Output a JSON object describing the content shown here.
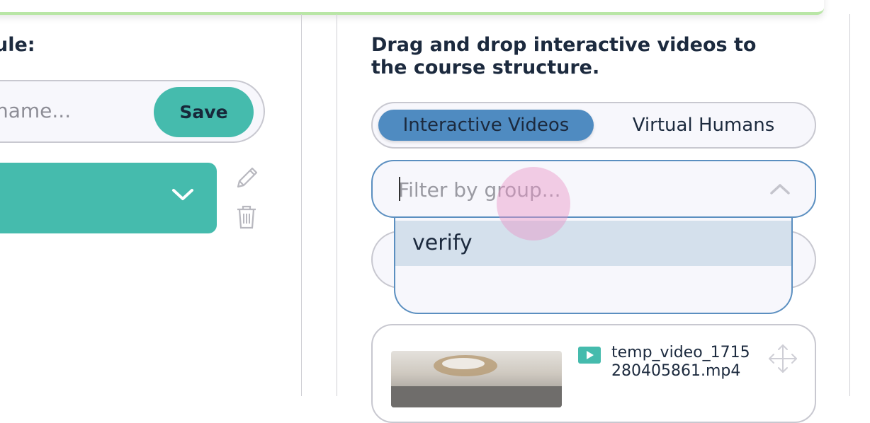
{
  "left_panel": {
    "heading": "ule:",
    "name_placeholder": "name...",
    "save_label": "Save"
  },
  "right_panel": {
    "heading": "Drag and drop interactive videos to the course structure.",
    "tabs": [
      {
        "label": "Interactive Videos",
        "active": true
      },
      {
        "label": "Virtual Humans",
        "active": false
      }
    ],
    "filter": {
      "placeholder": "Filter by group...",
      "value": "",
      "expanded": true,
      "options": [
        "verify"
      ]
    },
    "videos": [
      {
        "filename": "temp_video_1715280405861.mp4"
      }
    ]
  },
  "icons": {
    "module_dropdown": "chevron-down-icon",
    "edit": "pencil-icon",
    "delete": "trash-icon",
    "filter_toggle": "chevron-up-icon",
    "video_type": "play-icon",
    "drag": "move-icon"
  },
  "colors": {
    "accent_teal": "#45bbad",
    "tab_active": "#4f8bc1",
    "option_highlight": "#d4e0ec",
    "top_border": "#b9e6a6"
  }
}
